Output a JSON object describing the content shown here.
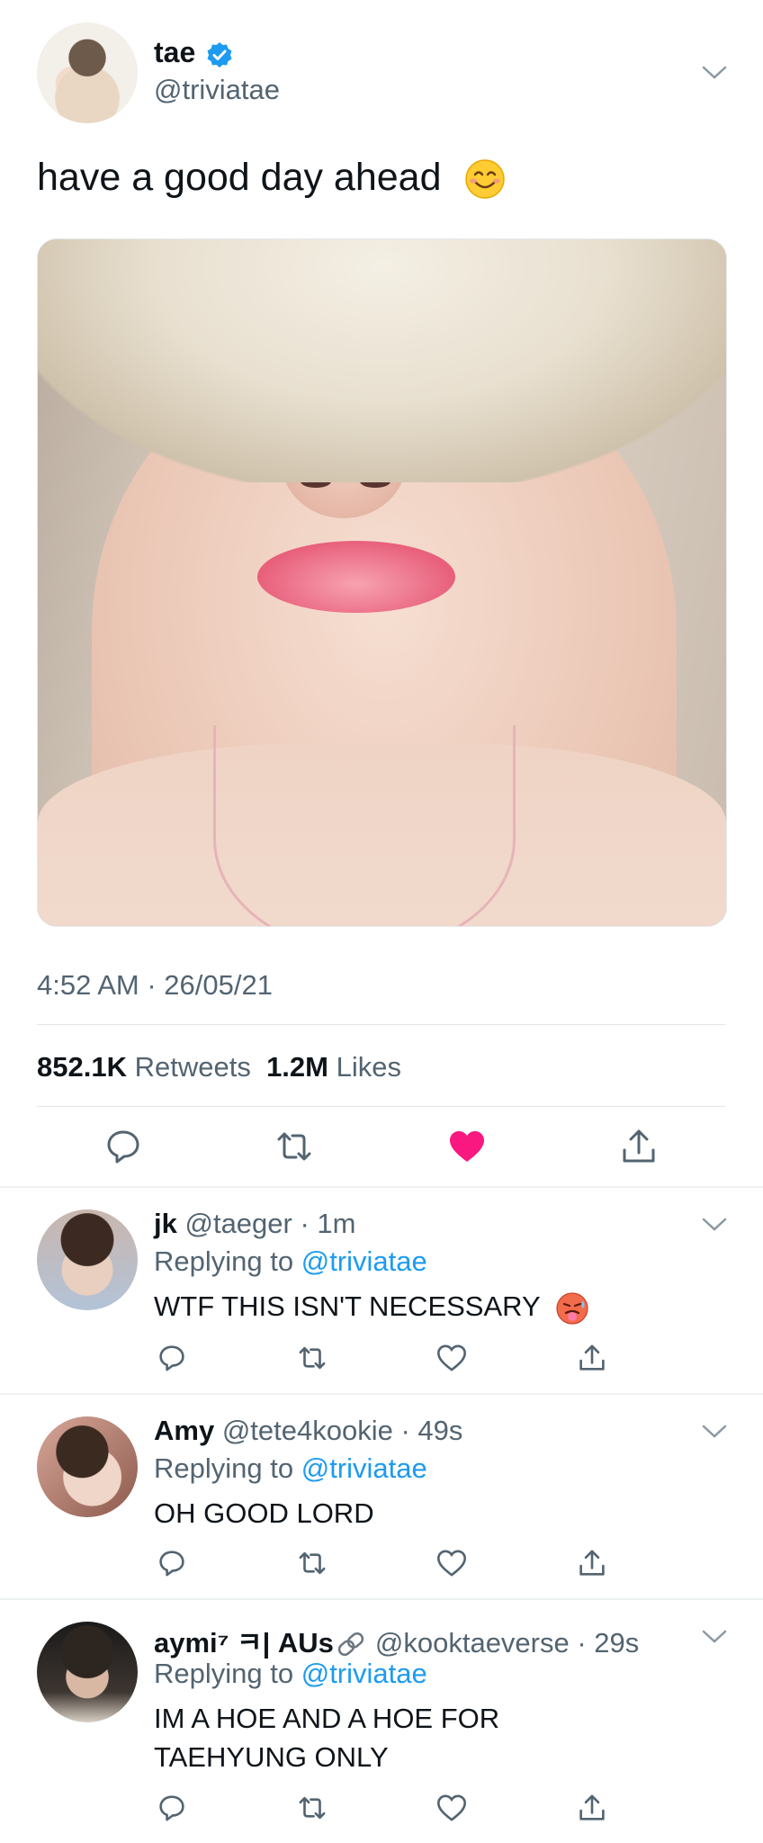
{
  "main_tweet": {
    "name": "tae",
    "handle": "@triviatae",
    "text": "have a good day ahead",
    "timestamp": "4:52 AM · 26/05/21",
    "retweets_count": "852.1K",
    "retweets_label": "Retweets",
    "likes_count": "1.2M",
    "likes_label": "Likes"
  },
  "replies": [
    {
      "name": "jk",
      "handle": "@taeger",
      "time": "· 1m",
      "replying_prefix": "Replying to",
      "replying_to": "@triviatae",
      "text": "WTF THIS ISN'T NECESSARY"
    },
    {
      "name": "Amy",
      "handle": "@tete4kookie",
      "time": "· 49s",
      "replying_prefix": "Replying to",
      "replying_to": "@triviatae",
      "text": "OH GOOD LORD"
    },
    {
      "name": "aymi⁷ ㅋ| AUs",
      "handle": "@kooktaeverse",
      "time": "· 29s",
      "replying_prefix": "Replying to",
      "replying_to": "@triviatae",
      "text_line1": "IM A HOE AND A HOE FOR",
      "text_line2": "TAEHYUNG ONLY"
    }
  ],
  "colors": {
    "accent": "#1d9bf0",
    "like": "#f91880",
    "secondary_text": "#536471"
  },
  "icons": [
    "verified-badge-icon",
    "chevron-down-icon",
    "smile-emoji-icon",
    "hot-face-emoji-icon",
    "link-icon",
    "reply-icon",
    "retweet-icon",
    "like-icon",
    "share-icon"
  ]
}
